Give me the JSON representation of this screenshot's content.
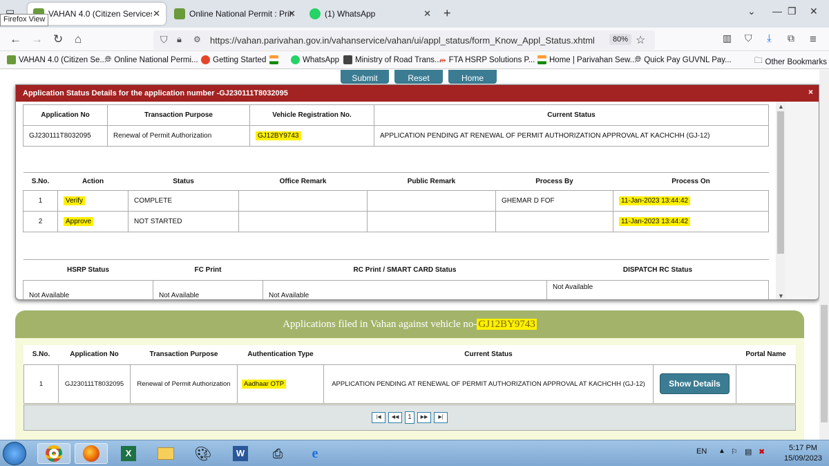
{
  "browser": {
    "tabs": [
      {
        "title": "VAHAN 4.0 (Citizen Services)~o",
        "active": true
      },
      {
        "title": "Online National Permit : Print N",
        "active": false
      },
      {
        "title": "(1) WhatsApp",
        "active": false
      }
    ],
    "firefox_view": "Firefox View",
    "url": "https://vahan.parivahan.gov.in/vahanservice/vahan/ui/appl_status/form_Know_Appl_Status.xhtml",
    "zoom": "80%",
    "bookmarks": [
      "VAHAN 4.0 (Citizen Se...",
      "Online National Permi...",
      "Getting Started",
      "WhatsApp",
      "Ministry of Road Trans...",
      "FTA HSRP Solutions P...",
      "Home | Parivahan Sew...",
      "Quick Pay GUVNL Pay..."
    ],
    "other_bookmarks": "Other Bookmarks"
  },
  "page": {
    "buttons": {
      "submit": "Submit",
      "reset": "Reset",
      "home": "Home"
    }
  },
  "modal": {
    "title": "Application Status Details for the application number -GJ230111T8032095",
    "close": "×",
    "summary": {
      "headers": [
        "Application No",
        "Transaction Purpose",
        "Vehicle Registration No.",
        "Current Status"
      ],
      "row": [
        "GJ230111T8032095",
        "Renewal of Permit Authorization",
        "GJ12BY9743",
        "APPLICATION PENDING AT RENEWAL OF PERMIT AUTHORIZATION APPROVAL AT KACHCHH (GJ-12)"
      ]
    },
    "actions": {
      "headers": [
        "S.No.",
        "Action",
        "Status",
        "Office Remark",
        "Public Remark",
        "Process By",
        "Process On"
      ],
      "rows": [
        [
          "1",
          "Verify",
          "COMPLETE",
          "",
          "",
          "GHEMAR D FOF",
          "11-Jan-2023 13:44:42"
        ],
        [
          "2",
          "Approve",
          "NOT STARTED",
          "",
          "",
          "",
          "11-Jan-2023 13:44:42"
        ]
      ]
    },
    "delivery": {
      "headers": [
        "HSRP Status",
        "FC Print",
        "RC Print / SMART CARD Status",
        "DISPATCH RC Status"
      ],
      "row": [
        "Not Available",
        "Not Available",
        "Not Available",
        "Not Available"
      ]
    }
  },
  "applications": {
    "heading_prefix": "Applications filed in Vahan against vehicle no-",
    "vehicle_no": "GJ12BY9743",
    "headers": [
      "S.No.",
      "Application No",
      "Transaction Purpose",
      "Authentication Type",
      "Current Status",
      "",
      "Portal Name"
    ],
    "row": [
      "1",
      "GJ230111T8032095",
      "Renewal of Permit Authorization",
      "Aadhaar OTP",
      "APPLICATION PENDING AT RENEWAL OF PERMIT AUTHORIZATION APPROVAL AT KACHCHH (GJ-12)",
      "",
      ""
    ],
    "show_details": "Show Details",
    "pager": {
      "first": "|◀",
      "prev": "◀◀",
      "current": "1",
      "next": "▶▶",
      "last": "▶|"
    }
  },
  "taskbar": {
    "lang": "EN",
    "time": "5:17 PM",
    "date": "15/09/2023"
  }
}
